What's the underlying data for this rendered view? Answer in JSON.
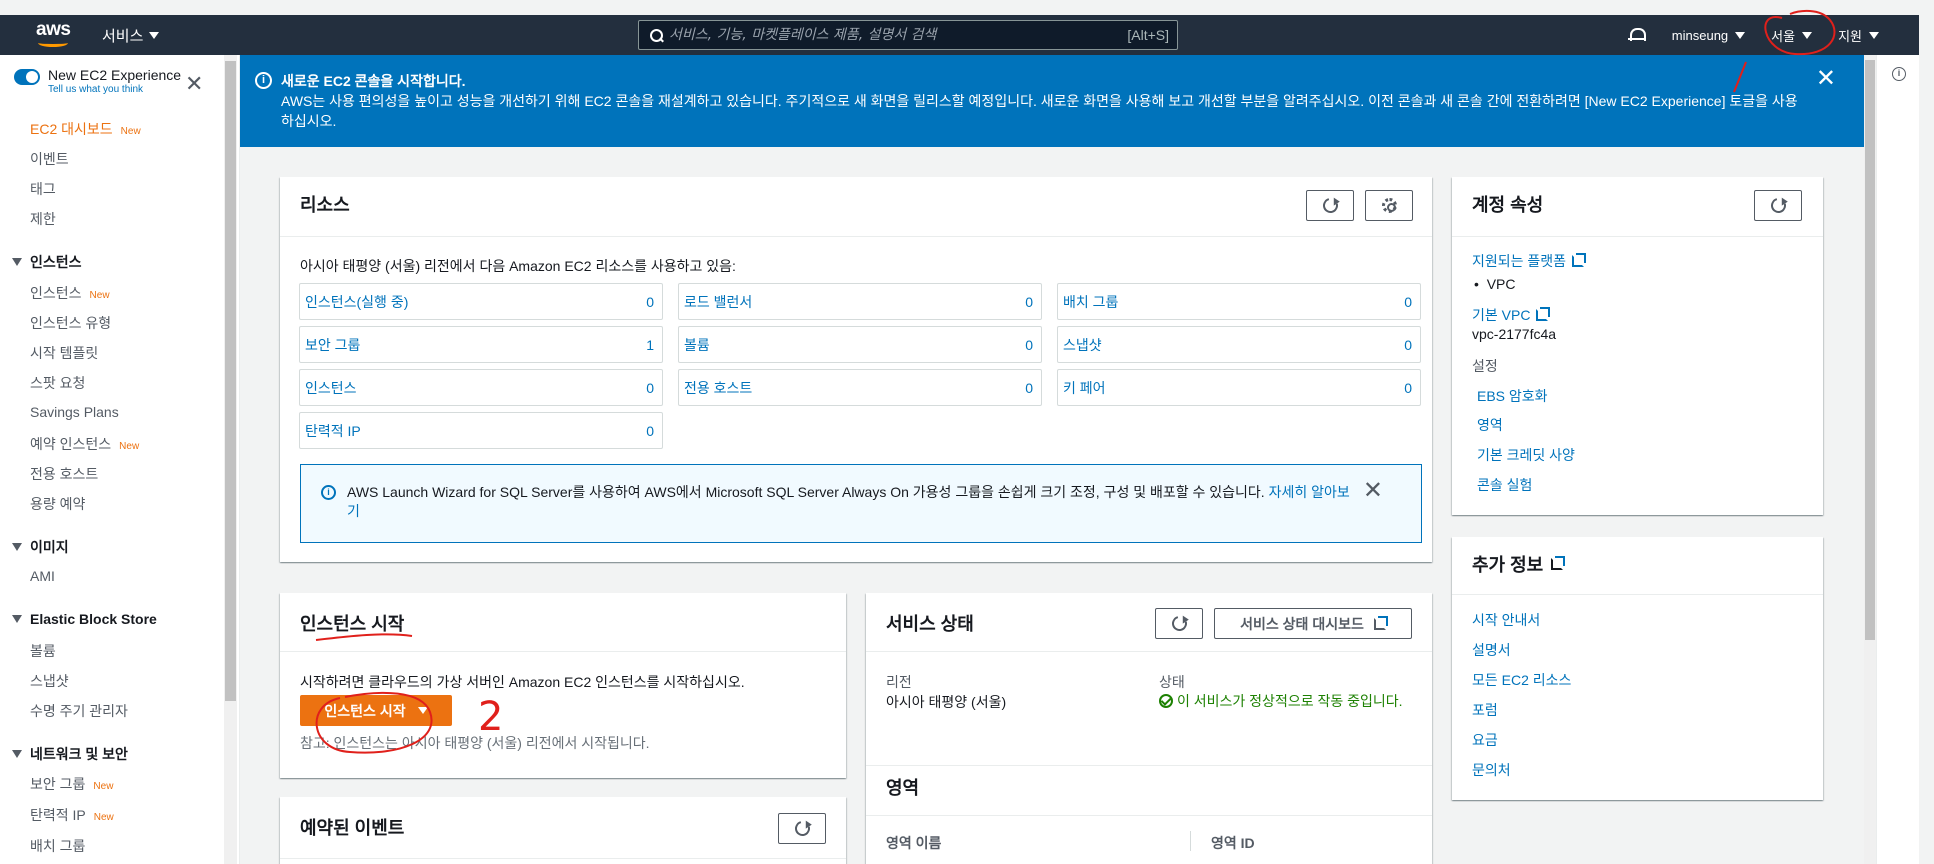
{
  "topnav": {
    "logo": "aws",
    "services": "서비스",
    "search_placeholder": "서비스, 기능, 마켓플레이스 제품, 설명서 검색",
    "search_shortcut": "[Alt+S]",
    "user": "minseung",
    "region": "서울",
    "support": "지원"
  },
  "sidebar": {
    "exp_title": "New EC2 Experience",
    "exp_sub": "Tell us what you think",
    "dashboard": "EC2 대시보드",
    "new": "New",
    "items_top": [
      "이벤트",
      "태그",
      "제한"
    ],
    "sec_instances": "인스턴스",
    "instances": [
      "인스턴스",
      "인스턴스 유형",
      "시작 템플릿",
      "스팟 요청",
      "Savings Plans",
      "예약 인스턴스",
      "전용 호스트",
      "용량 예약"
    ],
    "sec_images": "이미지",
    "images": [
      "AMI"
    ],
    "sec_ebs": "Elastic Block Store",
    "ebs": [
      "볼륨",
      "스냅샷",
      "수명 주기 관리자"
    ],
    "sec_network": "네트워크 및 보안",
    "network": [
      "보안 그룹",
      "탄력적 IP",
      "배치 그룹"
    ]
  },
  "banner": {
    "title": "새로운 EC2 콘솔을 시작합니다.",
    "text": "AWS는 사용 편의성을 높이고 성능을 개선하기 위해 EC2 콘솔을 재설계하고 있습니다. 주기적으로 새 화면을 릴리스할 예정입니다. 새로운 화면을 사용해 보고 개선할 부분을 알려주십시오. 이전 콘솔과 새 콘솔 간에 전환하려면 [New EC2 Experience] 토글을 사용하십시오."
  },
  "resources": {
    "title": "리소스",
    "intro": "아시아 태평양 (서울) 리전에서 다음 Amazon EC2 리소스를 사용하고 있음:",
    "cells": [
      {
        "label": "인스턴스(실행 중)",
        "count": "0"
      },
      {
        "label": "로드 밸런서",
        "count": "0"
      },
      {
        "label": "배치 그룹",
        "count": "0"
      },
      {
        "label": "보안 그룹",
        "count": "1"
      },
      {
        "label": "볼륨",
        "count": "0"
      },
      {
        "label": "스냅샷",
        "count": "0"
      },
      {
        "label": "인스턴스",
        "count": "0"
      },
      {
        "label": "전용 호스트",
        "count": "0"
      },
      {
        "label": "키 페어",
        "count": "0"
      },
      {
        "label": "탄력적 IP",
        "count": "0"
      }
    ],
    "alert_text": "AWS Launch Wizard for SQL Server를 사용하여 AWS에서 Microsoft SQL Server Always On 가용성 그룹을 손쉽게 크기 조정, 구성 및 배포할 수 있습니다. ",
    "alert_link": "자세히 알아보기"
  },
  "account": {
    "title": "계정 속성",
    "platforms": "지원되는 플랫폼",
    "vpc_bullet": "VPC",
    "default_vpc": "기본 VPC",
    "vpc_id": "vpc-2177fc4a",
    "settings": "설정",
    "settings_links": [
      "EBS 암호화",
      "영역",
      "기본 크레딧 사양",
      "콘솔 실험"
    ]
  },
  "extra": {
    "title": "추가 정보",
    "links": [
      "시작 안내서",
      "설명서",
      "모든 EC2 리소스",
      "포럼",
      "요금",
      "문의처"
    ]
  },
  "launch": {
    "title": "인스턴스 시작",
    "desc": "시작하려면 클라우드의 가상 서버인 Amazon EC2 인스턴스를 시작하십시오.",
    "button": "인스턴스 시작",
    "note": "참고: 인스턴스는 아시아 태평양 (서울) 리전에서 시작됩니다."
  },
  "health": {
    "title": "서비스 상태",
    "dashboard_btn": "서비스 상태 대시보드",
    "region_label": "리전",
    "region_value": "아시아 태평양 (서울)",
    "status_label": "상태",
    "status_value": "이 서비스가 정상적으로 작동 중입니다."
  },
  "zones": {
    "title": "영역",
    "col_name": "영역 이름",
    "col_id": "영역 ID"
  },
  "events": {
    "title": "예약된 이벤트"
  },
  "annotation": {
    "number": "2"
  }
}
